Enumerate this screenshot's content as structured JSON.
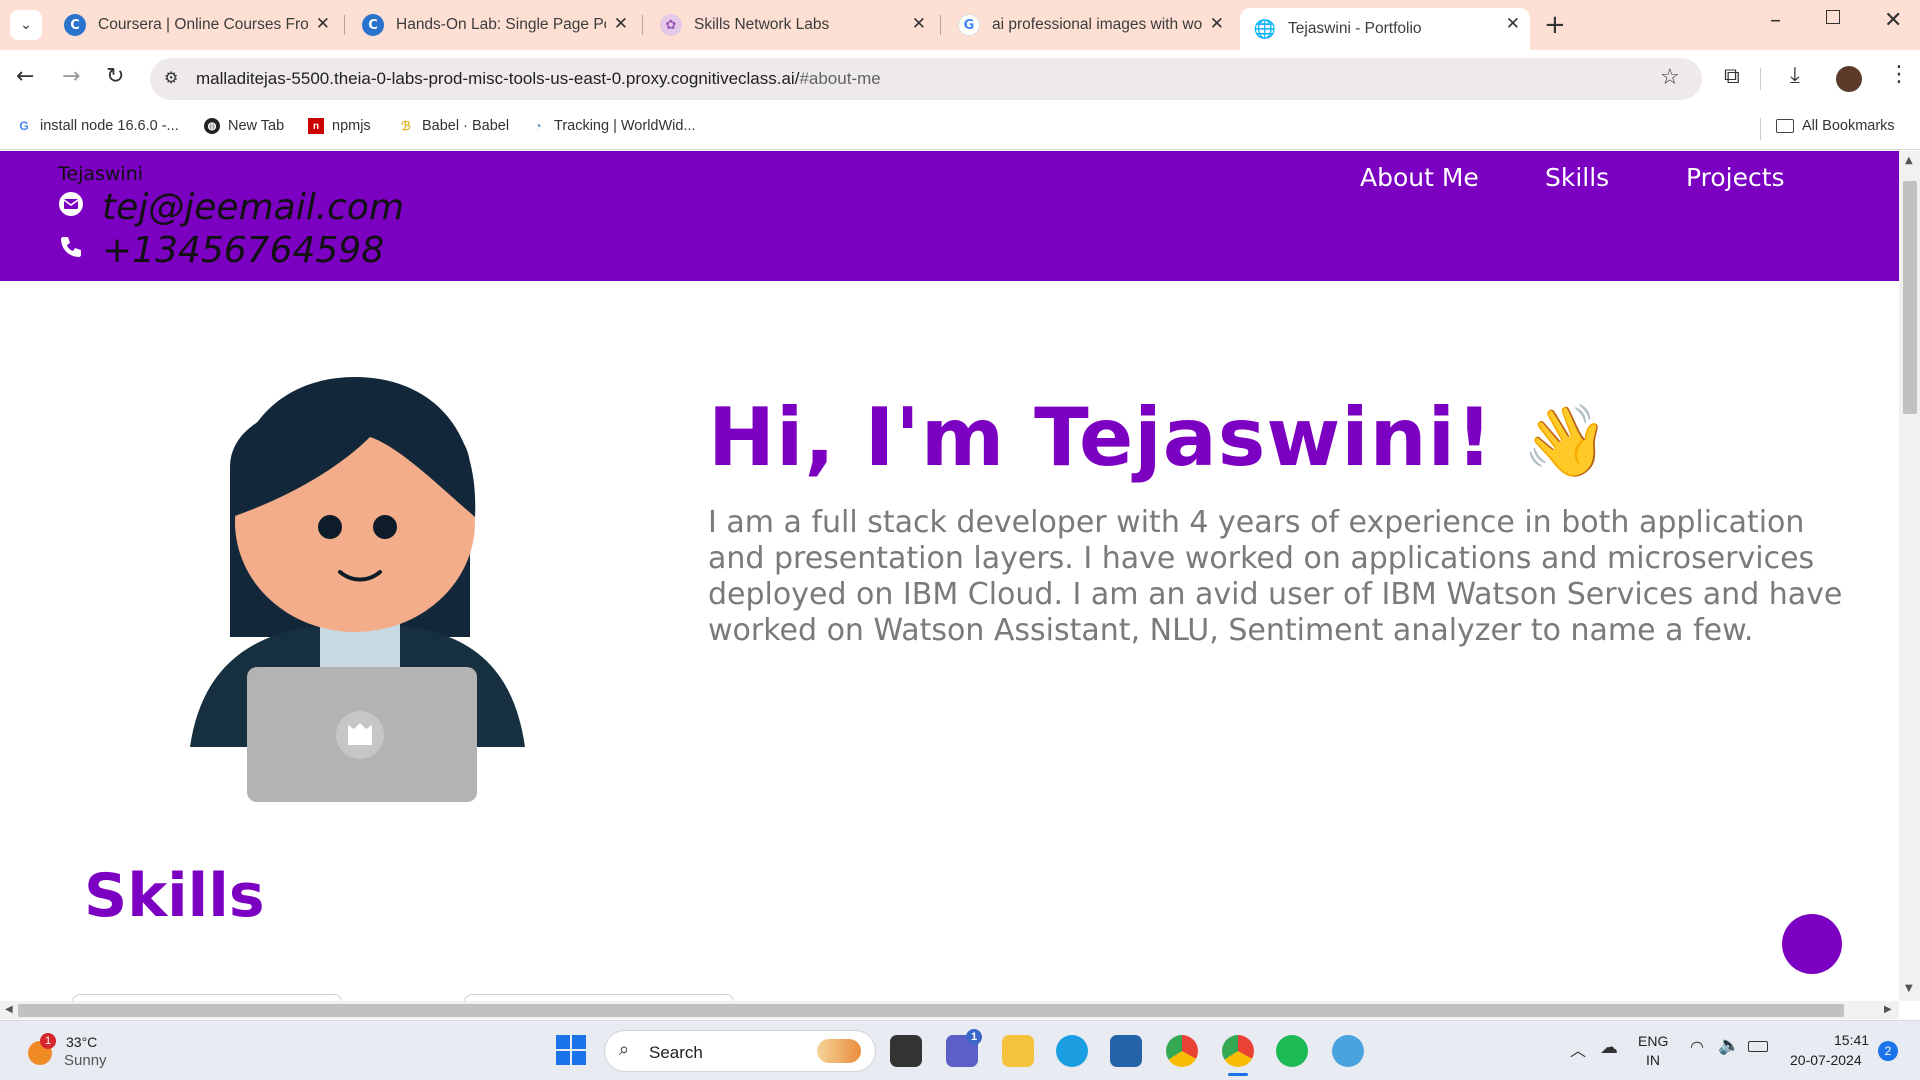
{
  "browser": {
    "tabs": [
      {
        "title": "Coursera | Online Courses From",
        "icon": "coursera-icon"
      },
      {
        "title": "Hands-On Lab: Single Page Port",
        "icon": "coursera-icon"
      },
      {
        "title": "Skills Network Labs",
        "icon": "skills-network-icon"
      },
      {
        "title": "ai professional images with wor",
        "icon": "google-icon"
      },
      {
        "title": "Tejaswini - Portfolio",
        "icon": "globe-icon",
        "active": true
      }
    ],
    "url_main": "malladitejas-5500.theia-0-labs-prod-misc-tools-us-east-0.proxy.cognitiveclass.ai/",
    "url_hash": "#about-me",
    "bookmarks": [
      {
        "label": "install node 16.6.0 -...",
        "icon": "google-icon"
      },
      {
        "label": "New Tab",
        "icon": "globe-icon"
      },
      {
        "label": "npmjs",
        "icon": "npm-icon"
      },
      {
        "label": "Babel · Babel",
        "icon": "babel-icon"
      },
      {
        "label": "Tracking | WorldWid...",
        "icon": "tracking-icon"
      }
    ],
    "all_bookmarks": "All Bookmarks"
  },
  "site": {
    "name": "Tejaswini",
    "email": "tej@jeemail.com",
    "phone": "+13456764598",
    "nav": [
      "About Me",
      "Skills",
      "Projects"
    ],
    "hero_title": "Hi, I'm Tejaswini!",
    "hero_emoji": "👋",
    "hero_text": "I am a full stack developer with 4 years of experience in both application and presentation layers. I have worked on applications and microservices deployed on IBM Cloud. I am an avid user of IBM Watson Services and have worked on Watson Assistant, NLU, Sentiment analyzer to name a few.",
    "skills_title": "Skills",
    "colors": {
      "accent": "#7b00c2",
      "body_text": "#7a7a7a"
    }
  },
  "taskbar": {
    "weather_temp": "33°C",
    "weather_desc": "Sunny",
    "weather_badge": "1",
    "search_placeholder": "Search",
    "teams_badge": "1",
    "lang_top": "ENG",
    "lang_bottom": "IN",
    "time": "15:41",
    "date": "20-07-2024",
    "notif_count": "2"
  }
}
